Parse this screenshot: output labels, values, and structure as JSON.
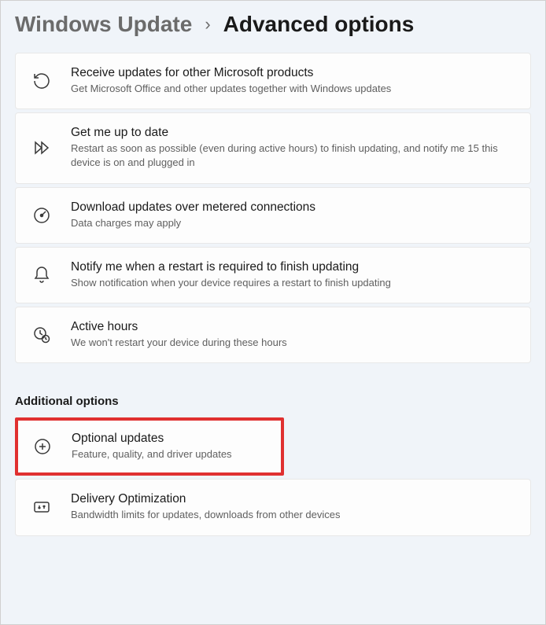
{
  "breadcrumb": {
    "parent": "Windows Update",
    "separator": "›",
    "current": "Advanced options"
  },
  "settings": {
    "receive_updates": {
      "title": "Receive updates for other Microsoft products",
      "desc": "Get Microsoft Office and other updates together with Windows updates"
    },
    "up_to_date": {
      "title": "Get me up to date",
      "desc": "Restart as soon as possible (even during active hours) to finish updating, and notify me 15 this device is on and plugged in"
    },
    "metered": {
      "title": "Download updates over metered connections",
      "desc": "Data charges may apply"
    },
    "notify_restart": {
      "title": "Notify me when a restart is required to finish updating",
      "desc": "Show notification when your device requires a restart to finish updating"
    },
    "active_hours": {
      "title": "Active hours",
      "desc": "We won't restart your device during these hours"
    }
  },
  "additional_header": "Additional options",
  "additional": {
    "optional_updates": {
      "title": "Optional updates",
      "desc": "Feature, quality, and driver updates"
    },
    "delivery_opt": {
      "title": "Delivery Optimization",
      "desc": "Bandwidth limits for updates, downloads from other devices"
    }
  }
}
